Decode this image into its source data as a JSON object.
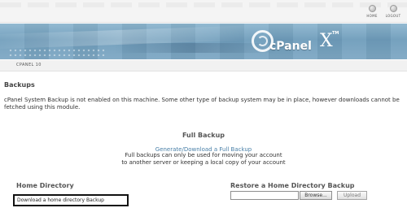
{
  "header": {
    "home_label": "HOME",
    "logout_label": "LOGOUT",
    "home_icon": "home-icon",
    "logout_icon": "logout-icon"
  },
  "banner": {
    "logo_text": "cPanel",
    "logo_x": "X",
    "logo_tm": "TM"
  },
  "breadcrumb": {
    "text": "CPANEL 10"
  },
  "main": {
    "title": "Backups",
    "notice": "cPanel System Backup is not enabled on this machine. Some other type of backup system may be in place, however downloads cannot be fetched using this module."
  },
  "full_backup": {
    "title": "Full Backup",
    "link": "Generate/Download a Full Backup",
    "desc_line1": "Full backups can only be used for moving your account",
    "desc_line2": "to another server or keeping a local copy of your account"
  },
  "home_directory": {
    "title": "Home Directory",
    "link": "Download a home directory Backup"
  },
  "restore": {
    "title": "Restore a Home Directory Backup",
    "file_value": "",
    "browse_label": "Browse...",
    "upload_label": "Upload"
  },
  "colors": {
    "link": "#4a80a8",
    "banner": "#7ea8c4"
  }
}
